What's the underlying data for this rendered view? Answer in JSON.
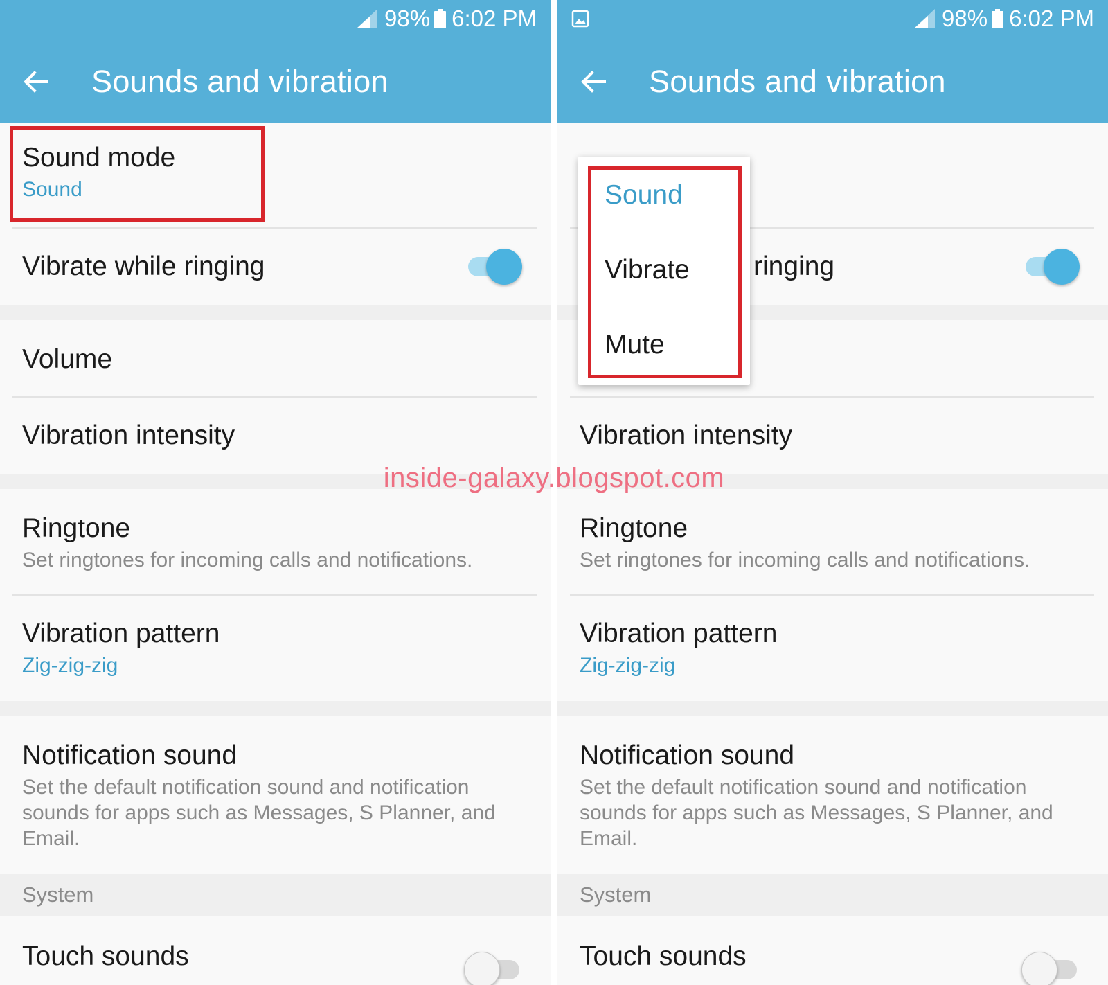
{
  "status": {
    "battery_level": "98%",
    "time": "6:02 PM"
  },
  "toolbar": {
    "title": "Sounds and vibration"
  },
  "settings": {
    "sound_mode": {
      "label": "Sound mode",
      "value": "Sound"
    },
    "vibrate_while_ringing": {
      "label": "Vibrate while ringing",
      "enabled": true
    },
    "volume": {
      "label": "Volume"
    },
    "vibration_intensity": {
      "label": "Vibration intensity"
    },
    "ringtone": {
      "label": "Ringtone",
      "summary": "Set ringtones for incoming calls and notifications."
    },
    "vibration_pattern": {
      "label": "Vibration pattern",
      "value": "Zig-zig-zig"
    },
    "notification_sound": {
      "label": "Notification sound",
      "summary": "Set the default notification sound and notification sounds for apps such as Messages, S Planner, and Email."
    },
    "system_header": "System",
    "touch_sounds": {
      "label": "Touch sounds",
      "enabled": false
    }
  },
  "right_panel": {
    "partial_vibrate_label": "ringing"
  },
  "sound_mode_popup": {
    "options": [
      "Sound",
      "Vibrate",
      "Mute"
    ],
    "selected": "Sound"
  },
  "watermark": "inside-galaxy.blogspot.com",
  "colors": {
    "appbar": "#56b0d8",
    "accent": "#3a9cc8",
    "highlight": "#d8262c",
    "watermark": "#ee6f82"
  },
  "icons": [
    "signal-icon",
    "battery-icon",
    "gallery-icon",
    "back-arrow-icon"
  ]
}
